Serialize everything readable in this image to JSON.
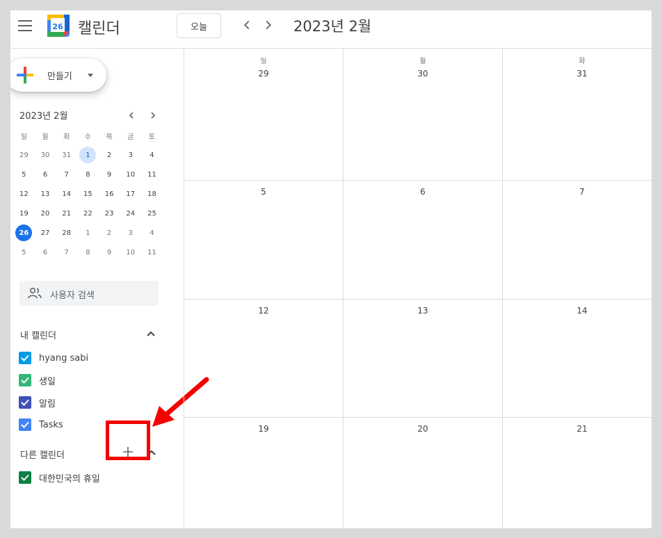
{
  "header": {
    "app_title": "캘린더",
    "logo_day": "26",
    "today_label": "오늘",
    "current_period": "2023년 2월"
  },
  "sidebar": {
    "create_label": "만들기",
    "mini_calendar": {
      "title": "2023년 2월",
      "weekdays": [
        "일",
        "월",
        "화",
        "수",
        "목",
        "금",
        "토"
      ],
      "weeks": [
        [
          "29",
          "30",
          "31",
          "1",
          "2",
          "3",
          "4"
        ],
        [
          "5",
          "6",
          "7",
          "8",
          "9",
          "10",
          "11"
        ],
        [
          "12",
          "13",
          "14",
          "15",
          "16",
          "17",
          "18"
        ],
        [
          "19",
          "20",
          "21",
          "22",
          "23",
          "24",
          "25"
        ],
        [
          "26",
          "27",
          "28",
          "1",
          "2",
          "3",
          "4"
        ],
        [
          "5",
          "6",
          "7",
          "8",
          "9",
          "10",
          "11"
        ]
      ],
      "selected_date": "1",
      "today_date": "26"
    },
    "search_people_label": "사용자 검색",
    "my_calendars": {
      "title": "내 캘린더",
      "items": [
        {
          "label": "hyang sabi",
          "color": "#039be5"
        },
        {
          "label": "생일",
          "color": "#33b679"
        },
        {
          "label": "알림",
          "color": "#3f51b5"
        },
        {
          "label": "Tasks",
          "color": "#4285f4"
        }
      ]
    },
    "other_calendars": {
      "title": "다른 캘린더",
      "items": [
        {
          "label": "대한민국의 휴일",
          "color": "#0b8043"
        }
      ]
    }
  },
  "main": {
    "weekdays": [
      "일",
      "월",
      "화"
    ],
    "weeks": [
      [
        "29",
        "30",
        "31"
      ],
      [
        "5",
        "6",
        "7"
      ],
      [
        "12",
        "13",
        "14"
      ],
      [
        "19",
        "20",
        "21"
      ]
    ]
  },
  "colors": {
    "accent_blue": "#1a73e8",
    "annotation_red": "#f40000"
  }
}
